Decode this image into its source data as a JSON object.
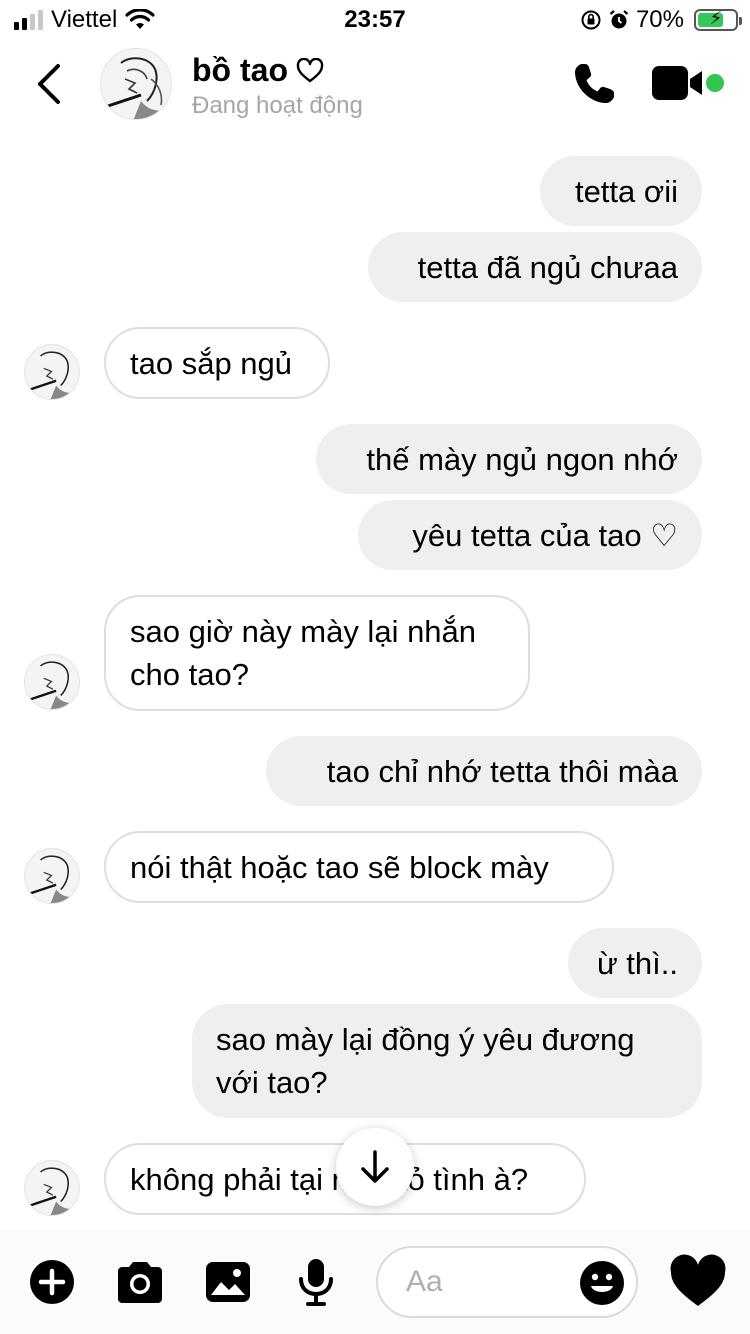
{
  "status_bar": {
    "carrier": "Viettel",
    "time": "23:57",
    "battery": "70%",
    "battery_level": 0.7,
    "icons": [
      "signal-icon",
      "wifi-icon",
      "orientation-lock-icon",
      "alarm-icon",
      "battery-charging-icon"
    ]
  },
  "header": {
    "name": "bồ tao",
    "status": "Đang hoạt động",
    "name_icon": "heart-outline-icon",
    "icons": [
      "back-icon",
      "avatar",
      "phone-icon",
      "video-call-icon",
      "online-dot-icon"
    ],
    "online_color": "#31c552"
  },
  "messages": [
    {
      "from": "me",
      "text": "tetta ơii"
    },
    {
      "from": "me",
      "text": "tetta đã ngủ chưaa"
    },
    {
      "from": "them",
      "text": "tao sắp ngủ"
    },
    {
      "from": "me",
      "text": "thế mày ngủ ngon nhớ"
    },
    {
      "from": "me",
      "text": "yêu tetta của tao ♡"
    },
    {
      "from": "them",
      "text": "sao giờ này mày lại nhắn cho tao?"
    },
    {
      "from": "me",
      "text": "tao chỉ nhớ tetta thôi màa"
    },
    {
      "from": "them",
      "text": "nói thật hoặc tao sẽ block mày"
    },
    {
      "from": "me",
      "text": "ừ thì.."
    },
    {
      "from": "me",
      "text": "sao mày lại đồng ý yêu đương với tao?"
    },
    {
      "from": "them",
      "text": "không phải tại mày tỏ tình à?"
    }
  ],
  "composer": {
    "placeholder": "Aa",
    "icons": [
      "plus-icon",
      "camera-icon",
      "image-icon",
      "microphone-icon",
      "emoji-icon",
      "heart-icon",
      "scroll-down-icon"
    ],
    "heart_color": "#000000"
  },
  "colors": {
    "outgoing_bubble": "#efefef",
    "incoming_border": "#dedede",
    "status_gray": "#a6a6a6"
  }
}
